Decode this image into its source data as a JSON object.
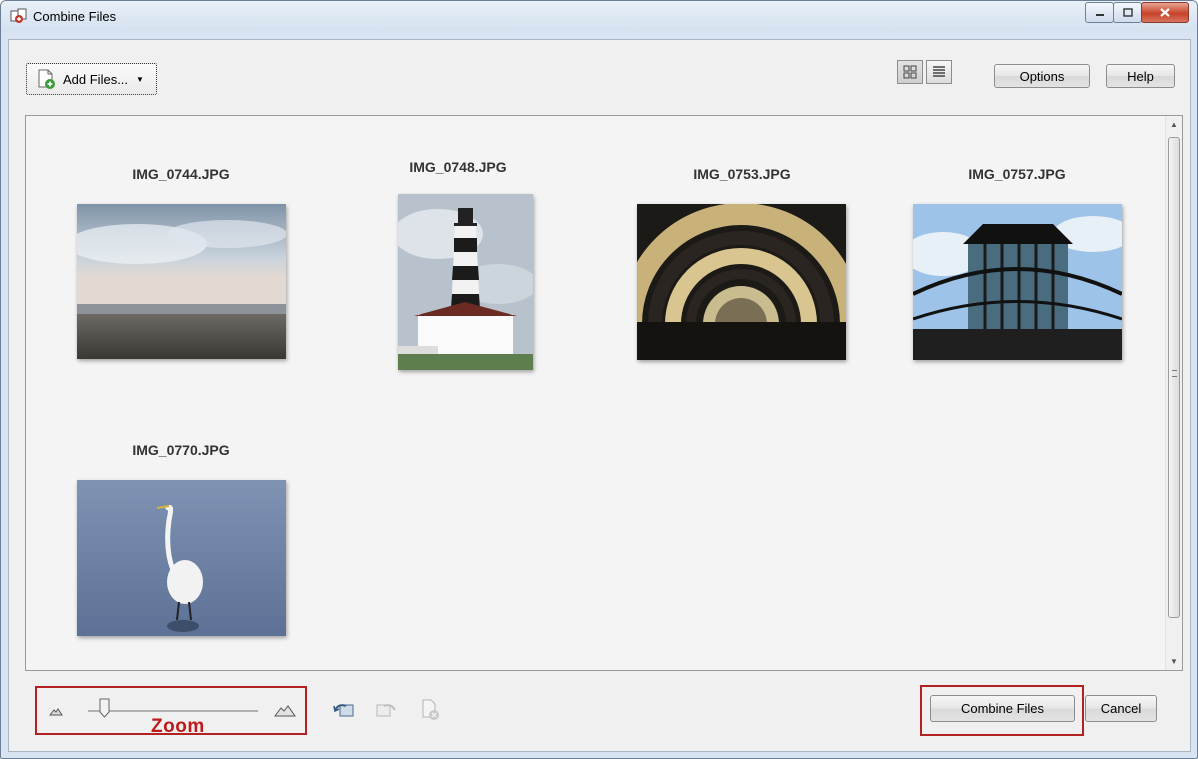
{
  "window": {
    "title": "Combine Files"
  },
  "toolbar": {
    "add_files_label": "Add Files...",
    "options_label": "Options",
    "help_label": "Help"
  },
  "files": [
    {
      "name": "IMG_0744.JPG"
    },
    {
      "name": "IMG_0748.JPG"
    },
    {
      "name": "IMG_0753.JPG"
    },
    {
      "name": "IMG_0757.JPG"
    },
    {
      "name": "IMG_0770.JPG"
    }
  ],
  "footer": {
    "zoom_label": "Zoom",
    "combine_label": "Combine Files",
    "cancel_label": "Cancel"
  },
  "colors": {
    "annotation_red": "#b22222",
    "window_frame": "#d8e4f1"
  }
}
